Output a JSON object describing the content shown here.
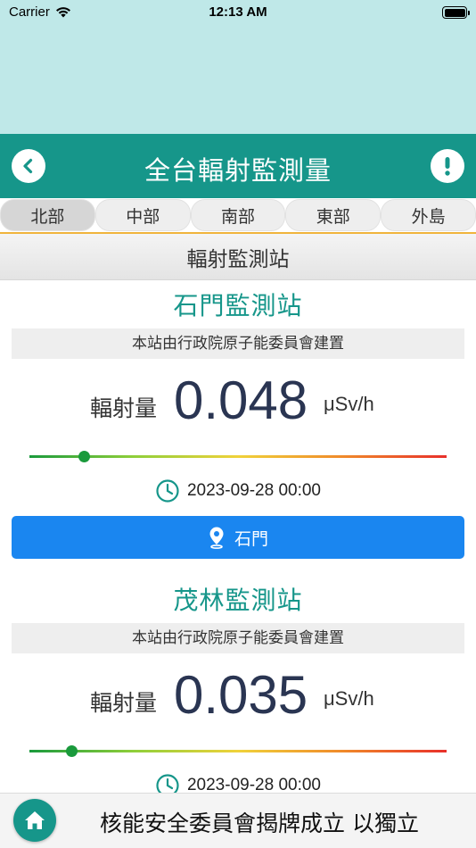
{
  "status_bar": {
    "carrier": "Carrier",
    "time": "12:13 AM"
  },
  "nav": {
    "title": "全台輻射監測量"
  },
  "tabs": [
    {
      "label": "北部",
      "active": true
    },
    {
      "label": "中部",
      "active": false
    },
    {
      "label": "南部",
      "active": false
    },
    {
      "label": "東部",
      "active": false
    },
    {
      "label": "外島",
      "active": false
    }
  ],
  "section_title": "輻射監測站",
  "stations": [
    {
      "name": "石門監測站",
      "note": "本站由行政院原子能委員會建置",
      "reading_label": "輻射量",
      "value": "0.048",
      "unit": "μSv/h",
      "level_fraction": 0.13,
      "timestamp": "2023-09-28 00:00",
      "location": "石門"
    },
    {
      "name": "茂林監測站",
      "note": "本站由行政院原子能委員會建置",
      "reading_label": "輻射量",
      "value": "0.035",
      "unit": "μSv/h",
      "level_fraction": 0.1,
      "timestamp": "2023-09-28 00:00"
    }
  ],
  "footer": {
    "marquee_text": "核能安全委員會揭牌成立 以獨立"
  },
  "colors": {
    "teal": "#16968a",
    "light_teal": "#bfe8e8",
    "blue_button": "#1a86f0",
    "value_text": "#2a3552",
    "tab_underline": "#f0b43c"
  },
  "icons": [
    "wifi-icon",
    "battery-icon",
    "back-chevron-icon",
    "info-exclamation-icon",
    "clock-icon",
    "location-pin-icon",
    "home-icon"
  ]
}
